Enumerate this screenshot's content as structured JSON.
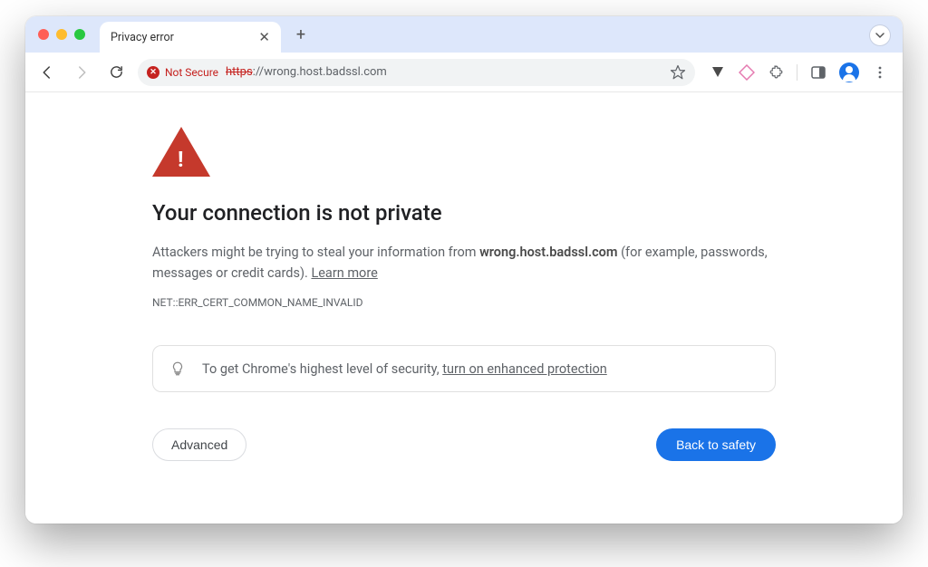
{
  "tab": {
    "title": "Privacy error"
  },
  "omnibox": {
    "not_secure_label": "Not Secure",
    "url_scheme": "https",
    "url_rest": "://wrong.host.badssl.com"
  },
  "page": {
    "heading": "Your connection is not private",
    "body_prefix": "Attackers might be trying to steal your information from ",
    "body_host": "wrong.host.badssl.com",
    "body_suffix": " (for example, passwords, messages or credit cards). ",
    "learn_more": "Learn more",
    "error_code": "NET::ERR_CERT_COMMON_NAME_INVALID",
    "promo_prefix": "To get Chrome's highest level of security, ",
    "promo_link": "turn on enhanced protection",
    "advanced_btn": "Advanced",
    "safety_btn": "Back to safety"
  }
}
